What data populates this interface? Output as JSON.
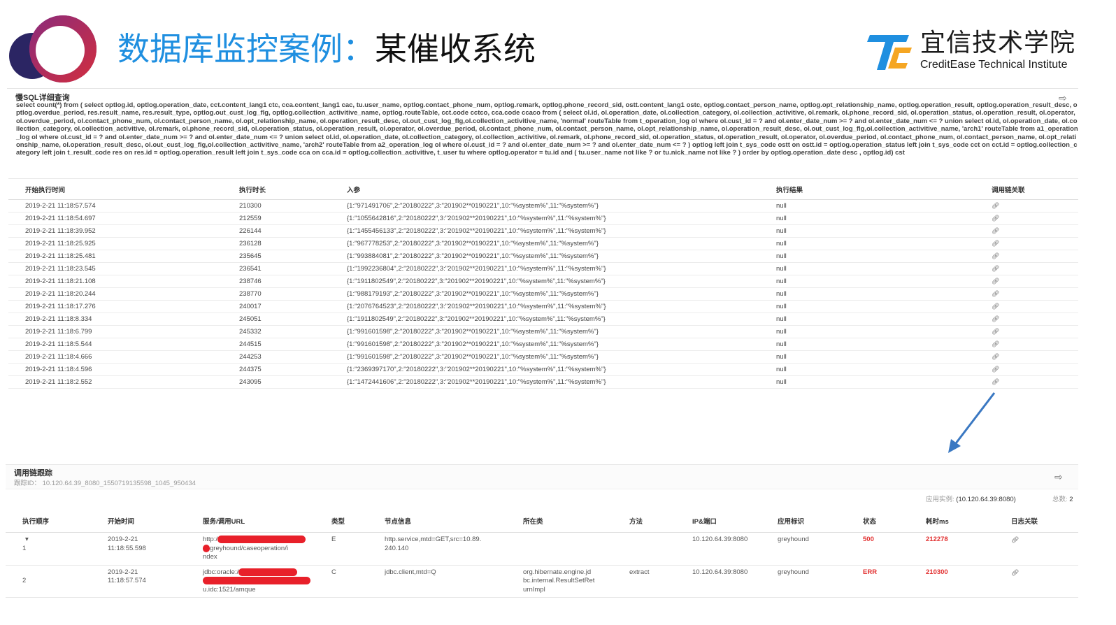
{
  "slide": {
    "title_blue": "数据库监控案例：",
    "title_black": "某催收系统",
    "brand_cn": "宜信技术学院",
    "brand_en": "CreditEase Technical Institute",
    "colors": {
      "title_blue": "#1f8fe0",
      "logo_navy": "#2b2563",
      "logo_purple": "#7b2f86",
      "logo_red": "#d22d3e"
    }
  },
  "sql_panel": {
    "title": "慢SQL详细查询",
    "query": "select count(*) from ( select optlog.id, optlog.operation_date, cct.content_lang1 ctc, cca.content_lang1 cac, tu.user_name, optlog.contact_phone_num, optlog.remark, optlog.phone_record_sid, ostt.content_lang1 ostc, optlog.contact_person_name, optlog.opt_relationship_name, optlog.operation_result, optlog.operation_result_desc, optlog.overdue_period, res.result_name, res.result_type, optlog.out_cust_log_flg, optlog.collection_activitive_name, optlog.routeTable, cct.code cctco, cca.code ccaco from ( select ol.id, ol.operation_date, ol.collection_category, ol.collection_activitive, ol.remark, ol.phone_record_sid, ol.operation_status, ol.operation_result, ol.operator, ol.overdue_period, ol.contact_phone_num, ol.contact_person_name, ol.opt_relationship_name, ol.operation_result_desc, ol.out_cust_log_flg,ol.collection_activitive_name, 'normal' routeTable from t_operation_log ol where ol.cust_id = ? and ol.enter_date_num >= ? and ol.enter_date_num <= ? union select ol.id, ol.operation_date, ol.collection_category, ol.collection_activitive, ol.remark, ol.phone_record_sid, ol.operation_status, ol.operation_result, ol.operator, ol.overdue_period, ol.contact_phone_num, ol.contact_person_name, ol.opt_relationship_name, ol.operation_result_desc, ol.out_cust_log_flg,ol.collection_activitive_name, 'arch1' routeTable from a1_operation_log ol where ol.cust_id = ? and ol.enter_date_num >= ? and ol.enter_date_num <= ? union select ol.id, ol.operation_date, ol.collection_category, ol.collection_activitive, ol.remark, ol.phone_record_sid, ol.operation_status, ol.operation_result, ol.operator, ol.overdue_period, ol.contact_phone_num, ol.contact_person_name, ol.opt_relationship_name, ol.operation_result_desc, ol.out_cust_log_flg,ol.collection_activitive_name, 'arch2' routeTable from a2_operation_log ol where ol.cust_id = ? and ol.enter_date_num >= ? and ol.enter_date_num <= ? ) optlog left join t_sys_code ostt on ostt.id = optlog.operation_status left join t_sys_code cct on cct.id = optlog.collection_category left join t_result_code res on res.id = optlog.operation_result left join t_sys_code cca on cca.id = optlog.collection_activitive, t_user tu where optlog.operator = tu.id and ( tu.user_name not like ? or tu.nick_name not like ? ) order by optlog.operation_date desc , optlog.id) cst",
    "columns": [
      "开始执行时间",
      "执行时长",
      "入参",
      "执行结果",
      "调用链关联"
    ],
    "rows": [
      [
        "2019-2-21 11:18:57.574",
        "210300",
        "{1:\"971491706\",2:\"20180222\",3:\"201902**0190221\",10:\"%system%\",11:\"%system%\"}",
        "null"
      ],
      [
        "2019-2-21 11:18:54.697",
        "212559",
        "{1:\"1055642816\",2:\"20180222\",3:\"201902**20190221\",10:\"%system%\",11:\"%system%\"}",
        "null"
      ],
      [
        "2019-2-21 11:18:39.952",
        "226144",
        "{1:\"1455456133\",2:\"20180222\",3:\"201902**20190221\",10:\"%system%\",11:\"%system%\"}",
        "null"
      ],
      [
        "2019-2-21 11:18:25.925",
        "236128",
        "{1:\"967778253\",2:\"20180222\",3:\"201902**0190221\",10:\"%system%\",11:\"%system%\"}",
        "null"
      ],
      [
        "2019-2-21 11:18:25.481",
        "235645",
        "{1:\"993884081\",2:\"20180222\",3:\"201902**0190221\",10:\"%system%\",11:\"%system%\"}",
        "null"
      ],
      [
        "2019-2-21 11:18:23.545",
        "236541",
        "{1:\"1992236804\",2:\"20180222\",3:\"201902**20190221\",10:\"%system%\",11:\"%system%\"}",
        "null"
      ],
      [
        "2019-2-21 11:18:21.108",
        "238746",
        "{1:\"1911802549\",2:\"20180222\",3:\"201902**20190221\",10:\"%system%\",11:\"%system%\"}",
        "null"
      ],
      [
        "2019-2-21 11:18:20.244",
        "238770",
        "{1:\"988179193\",2:\"20180222\",3:\"201902**0190221\",10:\"%system%\",11:\"%system%\"}",
        "null"
      ],
      [
        "2019-2-21 11:18:17.276",
        "240017",
        "{1:\"2076764523\",2:\"20180222\",3:\"201902**20190221\",10:\"%system%\",11:\"%system%\"}",
        "null"
      ],
      [
        "2019-2-21 11:18:8.334",
        "245051",
        "{1:\"1911802549\",2:\"20180222\",3:\"201902**20190221\",10:\"%system%\",11:\"%system%\"}",
        "null"
      ],
      [
        "2019-2-21 11:18:6.799",
        "245332",
        "{1:\"991601598\",2:\"20180222\",3:\"201902**0190221\",10:\"%system%\",11:\"%system%\"}",
        "null"
      ],
      [
        "2019-2-21 11:18:5.544",
        "244515",
        "{1:\"991601598\",2:\"20180222\",3:\"201902**0190221\",10:\"%system%\",11:\"%system%\"}",
        "null"
      ],
      [
        "2019-2-21 11:18:4.666",
        "244253",
        "{1:\"991601598\",2:\"20180222\",3:\"201902**0190221\",10:\"%system%\",11:\"%system%\"}",
        "null"
      ],
      [
        "2019-2-21 11:18:4.596",
        "244375",
        "{1:\"2369397170\",2:\"20180222\",3:\"201902**20190221\",10:\"%system%\",11:\"%system%\"}",
        "null"
      ],
      [
        "2019-2-21 11:18:2.552",
        "243095",
        "{1:\"1472441606\",2:\"20180222\",3:\"201902**20190221\",10:\"%system%\",11:\"%system%\"}",
        "null"
      ]
    ]
  },
  "trace_panel": {
    "title": "调用链跟踪",
    "trace_id": "跟踪ID： 10.120.64.39_8080_1550719135598_1045_950434",
    "instance_label": "应用实例:",
    "instance_value": "(10.120.64.39:8080)",
    "total_label": "总数:",
    "total_value": "2",
    "columns": [
      "执行顺序",
      "开始时间",
      "服务/调用URL",
      "类型",
      "节点信息",
      "所在类",
      "方法",
      "IP&端口",
      "应用标识",
      "状态",
      "耗时ms",
      "日志关联"
    ],
    "rows": [
      {
        "order_toggle": "▾",
        "order": "1",
        "start_date": "2019-2-21",
        "start_time": "11:18:55.598",
        "url_prefix": "http:/",
        "url_suffix": "greyhound/caseoperation/i",
        "url_tail": "ndex",
        "type": "E",
        "node_line1": "http.service,mtd=GET,src=10.89.",
        "node_line2": "240.140",
        "class_line1": "",
        "class_line2": "",
        "class_line3": "",
        "method": "",
        "ip": "10.120.64.39:8080",
        "app": "greyhound",
        "status": "500",
        "cost": "212278"
      },
      {
        "order_toggle": "",
        "order": "2",
        "start_date": "2019-2-21",
        "start_time": "11:18:57.574",
        "url_prefix": "jdbc:oracle:/",
        "url_suffix": "",
        "url_tail": "u.idc:1521/amque",
        "type": "C",
        "node_line1": "jdbc.client,mtd=Q",
        "node_line2": "",
        "class_line1": "org.hibernate.engine.jd",
        "class_line2": "bc.internal.ResultSetRet",
        "class_line3": "urnImpl",
        "method": "extract",
        "ip": "10.120.64.39:8080",
        "app": "greyhound",
        "status": "ERR",
        "cost": "210300"
      }
    ]
  },
  "icons": {
    "export": "export-icon",
    "link": "link-icon",
    "arrow": "arrow-down-left-icon"
  }
}
